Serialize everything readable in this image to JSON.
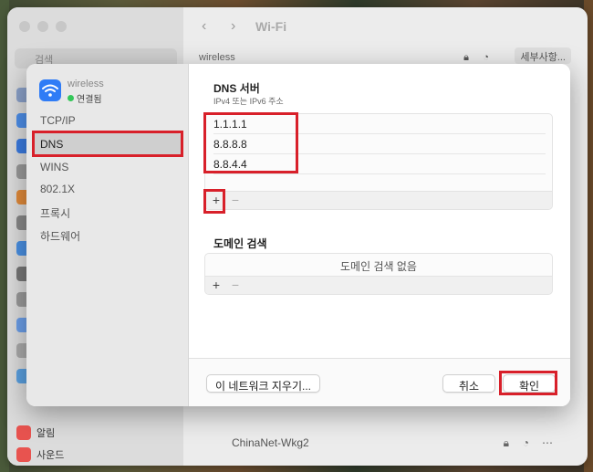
{
  "background": {
    "search_placeholder": "검색",
    "window_title": "Wi-Fi",
    "current_network": "wireless",
    "details_button": "세부사항...",
    "sidebar_bottom_items": [
      "알림",
      "사운드"
    ],
    "network_row_name": "ChinaNet-Wkg2"
  },
  "sheet": {
    "network": {
      "name": "wireless",
      "status": "연결됨"
    },
    "tabs": [
      "TCP/IP",
      "DNS",
      "WINS",
      "802.1X",
      "프록시",
      "하드웨어"
    ],
    "active_tab": "DNS",
    "dns": {
      "title": "DNS 서버",
      "subtitle": "IPv4 또는 IPv6 주소",
      "servers": [
        "1.1.1.1",
        "8.8.8.8",
        "8.8.4.4"
      ],
      "add": "+",
      "remove": "−"
    },
    "search_domains": {
      "title": "도메인 검색",
      "empty_text": "도메인 검색 없음",
      "add": "+",
      "remove": "−"
    },
    "buttons": {
      "forget": "이 네트워크 지우기...",
      "cancel": "취소",
      "ok": "확인"
    }
  },
  "colors": {
    "highlight": "#d8202a",
    "wifi_badge": "#2f7cf6",
    "connected": "#34c759"
  }
}
